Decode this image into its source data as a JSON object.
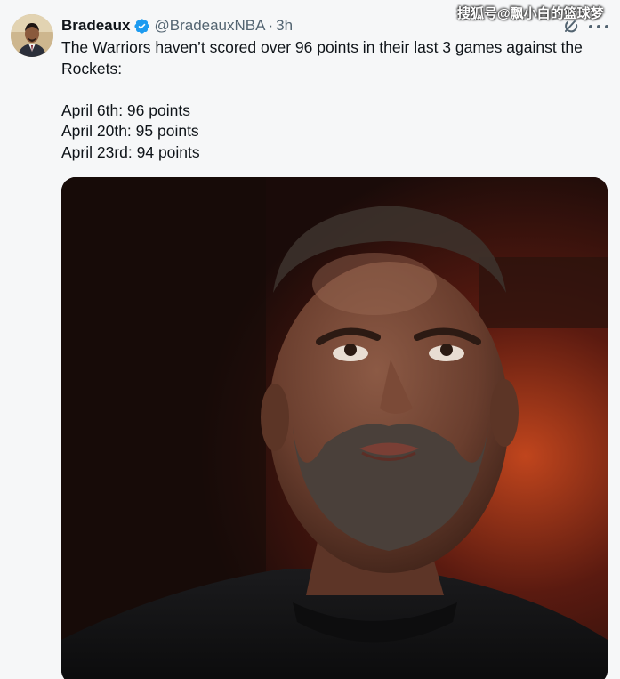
{
  "tweet": {
    "author_name": "Bradeaux",
    "handle": "@BradeauxNBA",
    "separator": "·",
    "timestamp": "3h",
    "text_intro": "The Warriors haven’t scored over 96 points in their last 3 games against the Rockets:",
    "lines": [
      "April 6th: 96 points",
      "April 20th: 95 points",
      "April 23rd: 94 points"
    ]
  },
  "watermark": "搜狐号@飘小白的篮球梦",
  "icons": {
    "verified": "verified-badge-icon",
    "grok": "grok-icon",
    "more": "more-options-icon"
  },
  "colors": {
    "verified_blue": "#1d9bf0",
    "text_primary": "#0f1419",
    "text_secondary": "#536471",
    "background": "#f6f7f8"
  }
}
